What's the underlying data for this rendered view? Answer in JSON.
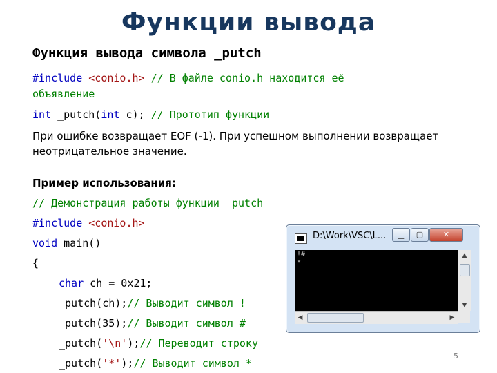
{
  "title": "Функции вывода",
  "heading": "Функция вывода символа _putch",
  "code_top": {
    "include_directive": "#include",
    "include_header": "<conio.h>",
    "include_comment": "// В файле conio.h находится её",
    "include_comment_cont": "объявление",
    "proto_kw1": "int",
    "proto_name": " _putch(",
    "proto_kw2": "int",
    "proto_rest": " c); ",
    "proto_comment": "// Прототип функции"
  },
  "description": "При ошибке возвращает EOF (-1). При успешном выполнении возвращает неотрицательное значение.",
  "example_label": "Пример использования:",
  "code_example": {
    "comment": "// Демонстрация работы функции _putch",
    "include_directive": "#include",
    "include_header": "<conio.h>",
    "main_kw": "void",
    "main_rest": " main()",
    "open_brace": "{",
    "char_kw": "char",
    "char_rest": " ch = 0x21;",
    "call1": "_putch(ch);",
    "call1_comment": "// Выводит символ !",
    "call2": "_putch(35);",
    "call2_comment": "// Выводит символ #",
    "call3_pre": "_putch(",
    "call3_str": "'\\n'",
    "call3_post": ");",
    "call3_comment": "// Переводит строку",
    "call4_pre": "_putch(",
    "call4_str": "'*'",
    "call4_post": ");",
    "call4_comment": "// Выводит символ *"
  },
  "console_window": {
    "title": "D:\\Work\\VSC\\L...",
    "minimize_glyph": "▁",
    "maximize_glyph": "▢",
    "close_glyph": "✕",
    "output_line1": "!#",
    "output_line2": "*",
    "icon": "console-app-icon",
    "scroll_up_glyph": "▲",
    "scroll_down_glyph": "▼",
    "scroll_left_glyph": "◀",
    "scroll_right_glyph": "▶"
  },
  "page_number": "5"
}
